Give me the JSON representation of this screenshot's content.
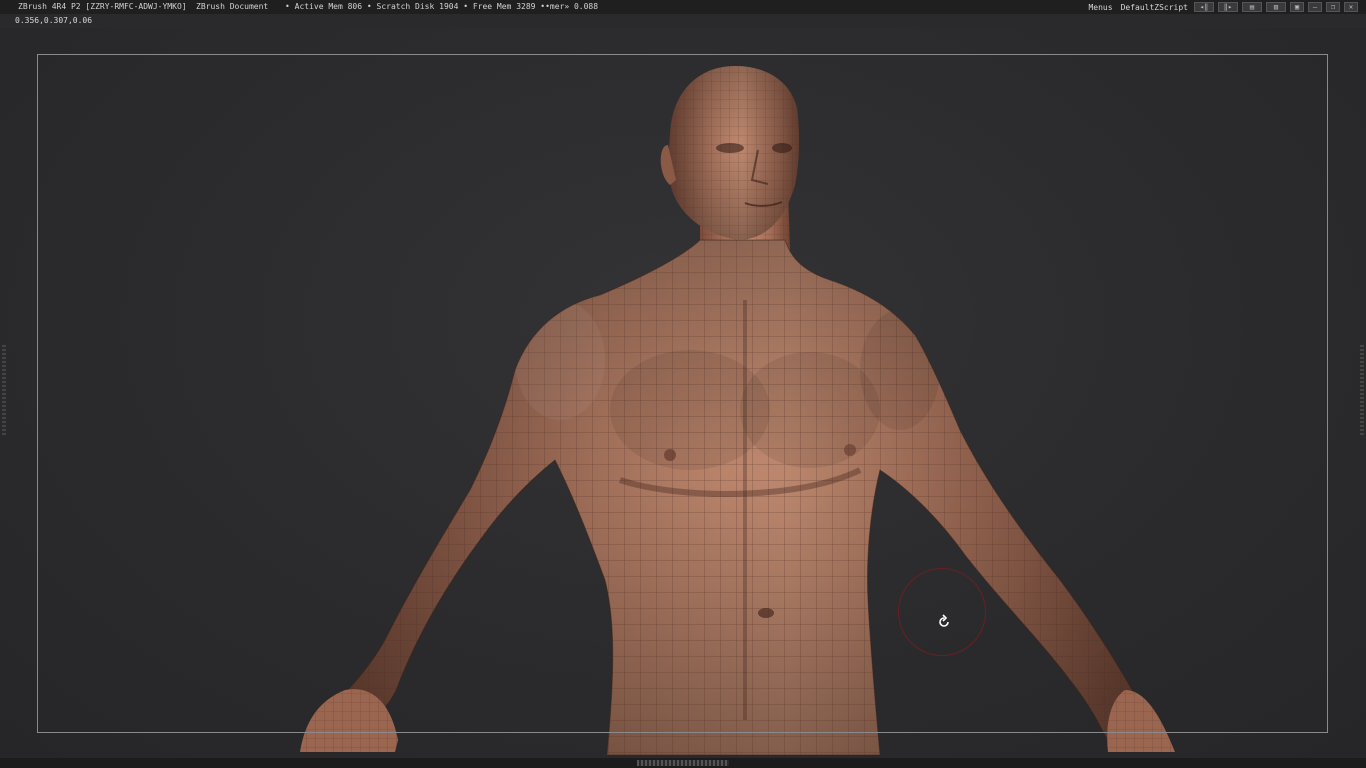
{
  "titlebar": {
    "app_title": "ZBrush 4R4 P2 [ZZRY-RMFC-ADWJ-YMKO]",
    "document": "ZBrush Document",
    "memory_status": "• Active Mem 806 • Scratch Disk 1904 • Free Mem 3289 ••mer» 0.088",
    "menus_label": "Menus",
    "script_label": "DefaultZScript"
  },
  "coordinates": "0.356,0.307,0.06",
  "icons": [
    "layout-icon",
    "layout-icon",
    "window-icon",
    "window-icon",
    "save-icon",
    "minimize-icon",
    "restore-icon",
    "close-icon"
  ],
  "colors": {
    "background": "#2a2a2c",
    "skin": "#a8705a",
    "wire": "#4a2a20",
    "cursor_ring": "#6a1f22"
  }
}
